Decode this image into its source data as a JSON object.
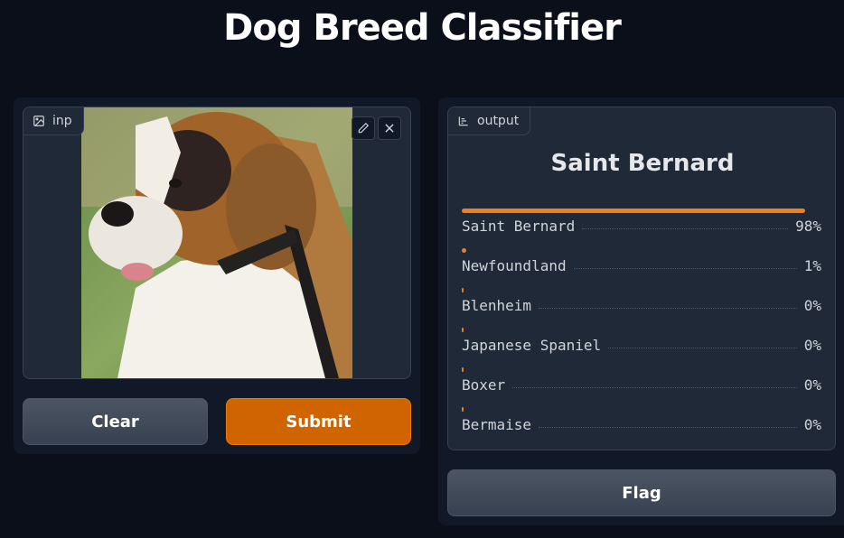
{
  "app": {
    "title": "Dog Breed Classifier"
  },
  "input": {
    "label": "inp",
    "label_icon": "image-icon",
    "edit_icon": "pencil-icon",
    "close_icon": "close-icon"
  },
  "buttons": {
    "clear": "Clear",
    "submit": "Submit",
    "flag": "Flag"
  },
  "output": {
    "label": "output",
    "label_icon": "bar-chart-icon",
    "prediction": "Saint Bernard",
    "confidences": [
      {
        "label": "Saint Bernard",
        "value": "98%",
        "fraction": 0.98
      },
      {
        "label": "Newfoundland",
        "value": "1%",
        "fraction": 0.01
      },
      {
        "label": "Blenheim",
        "value": "0%",
        "fraction": 0.0
      },
      {
        "label": "Japanese Spaniel",
        "value": "0%",
        "fraction": 0.0
      },
      {
        "label": "Boxer",
        "value": "0%",
        "fraction": 0.0
      },
      {
        "label": "Bermaise",
        "value": "0%",
        "fraction": 0.0
      }
    ]
  },
  "colors": {
    "accent": "#d06500",
    "bar": "#ee7f1c",
    "background": "#0b0f19",
    "panel": "#111827"
  }
}
